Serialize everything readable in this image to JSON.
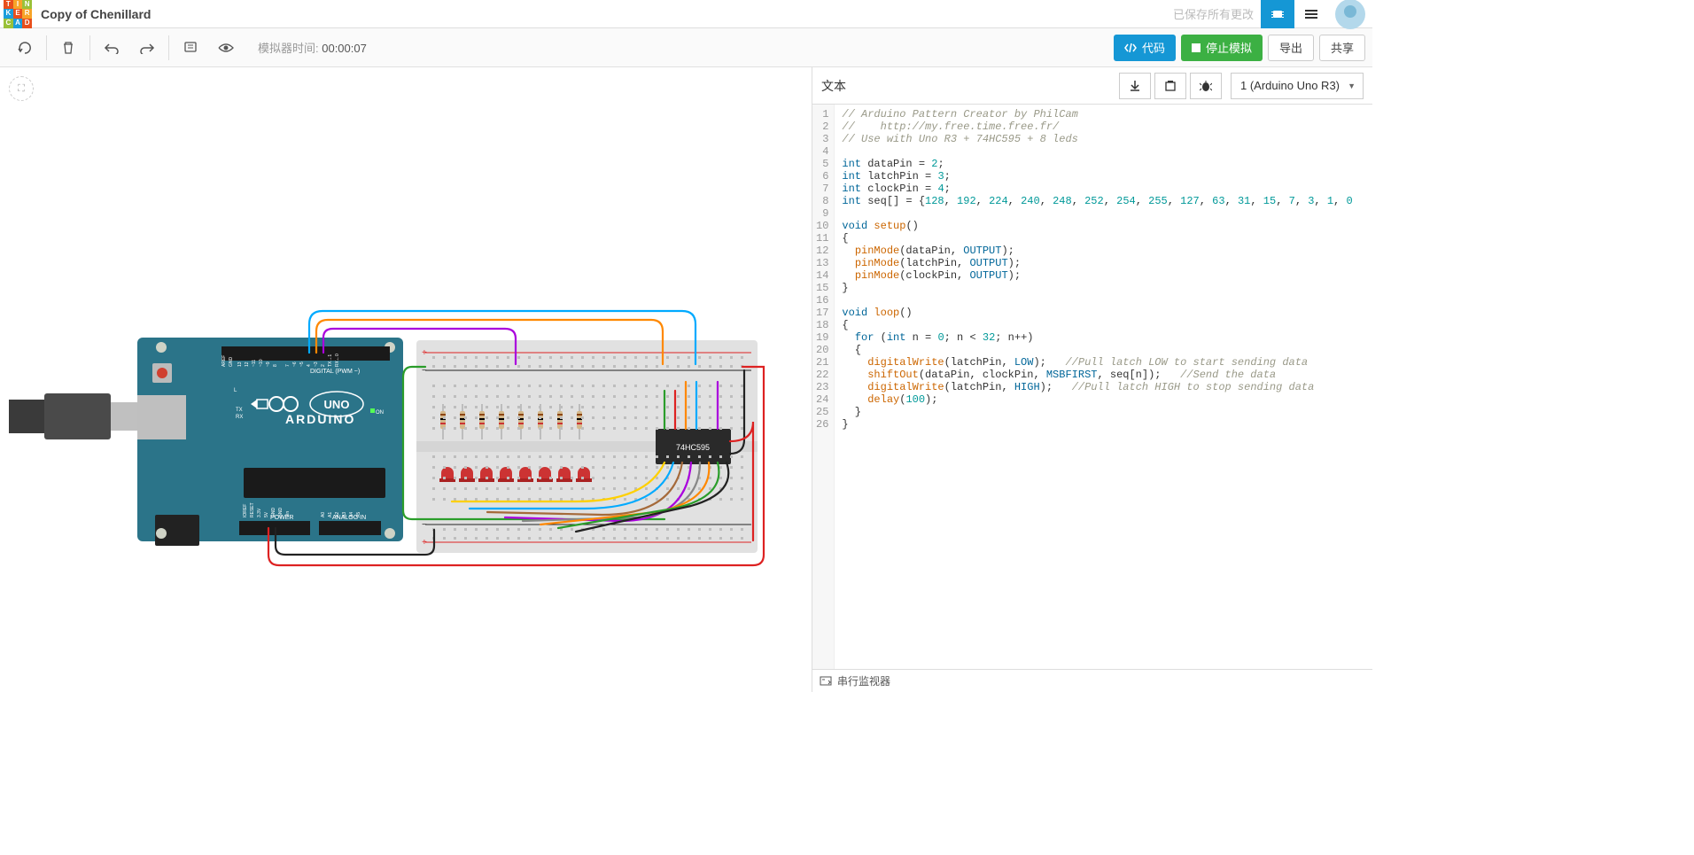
{
  "project_title": "Copy of Chenillard",
  "saved_text": "已保存所有更改",
  "toolbar": {
    "sim_time_label": "模拟器时间: ",
    "sim_time_value": "00:00:07",
    "code_btn": "代码",
    "stop_sim_btn": "停止模拟",
    "export_btn": "导出",
    "share_btn": "共享"
  },
  "code_panel": {
    "label": "文本",
    "board": "1 (Arduino Uno R3)",
    "serial_monitor": "串行监视器"
  },
  "chip_label": "74HC595",
  "arduino": {
    "brand": "ARDUINO",
    "model": "UNO",
    "digital_label": "DIGITAL (PWM ~)",
    "analog_label": "ANALOG IN",
    "power_label": "POWER",
    "tx": "TX",
    "rx": "RX",
    "on": "ON",
    "l": "L"
  },
  "code": {
    "lines": [
      {
        "n": 1,
        "t": "// Arduino Pattern Creator by PhilCam",
        "cls": "com"
      },
      {
        "n": 2,
        "t": "//    http://my.free.time.free.fr/",
        "cls": "com"
      },
      {
        "n": 3,
        "t": "// Use with Uno R3 + 74HC595 + 8 leds",
        "cls": "com"
      },
      {
        "n": 4,
        "t": "",
        "cls": ""
      },
      {
        "n": 5,
        "seg": [
          {
            "t": "int",
            "c": "ty"
          },
          {
            "t": " dataPin = ",
            "c": ""
          },
          {
            "t": "2",
            "c": "num"
          },
          {
            "t": ";",
            "c": ""
          }
        ]
      },
      {
        "n": 6,
        "seg": [
          {
            "t": "int",
            "c": "ty"
          },
          {
            "t": " latchPin = ",
            "c": ""
          },
          {
            "t": "3",
            "c": "num"
          },
          {
            "t": ";",
            "c": ""
          }
        ]
      },
      {
        "n": 7,
        "seg": [
          {
            "t": "int",
            "c": "ty"
          },
          {
            "t": " clockPin = ",
            "c": ""
          },
          {
            "t": "4",
            "c": "num"
          },
          {
            "t": ";",
            "c": ""
          }
        ]
      },
      {
        "n": 8,
        "seg": [
          {
            "t": "int",
            "c": "ty"
          },
          {
            "t": " seq[] = {",
            "c": ""
          },
          {
            "t": "128",
            "c": "num"
          },
          {
            "t": ", ",
            "c": ""
          },
          {
            "t": "192",
            "c": "num"
          },
          {
            "t": ", ",
            "c": ""
          },
          {
            "t": "224",
            "c": "num"
          },
          {
            "t": ", ",
            "c": ""
          },
          {
            "t": "240",
            "c": "num"
          },
          {
            "t": ", ",
            "c": ""
          },
          {
            "t": "248",
            "c": "num"
          },
          {
            "t": ", ",
            "c": ""
          },
          {
            "t": "252",
            "c": "num"
          },
          {
            "t": ", ",
            "c": ""
          },
          {
            "t": "254",
            "c": "num"
          },
          {
            "t": ", ",
            "c": ""
          },
          {
            "t": "255",
            "c": "num"
          },
          {
            "t": ", ",
            "c": ""
          },
          {
            "t": "127",
            "c": "num"
          },
          {
            "t": ", ",
            "c": ""
          },
          {
            "t": "63",
            "c": "num"
          },
          {
            "t": ", ",
            "c": ""
          },
          {
            "t": "31",
            "c": "num"
          },
          {
            "t": ", ",
            "c": ""
          },
          {
            "t": "15",
            "c": "num"
          },
          {
            "t": ", ",
            "c": ""
          },
          {
            "t": "7",
            "c": "num"
          },
          {
            "t": ", ",
            "c": ""
          },
          {
            "t": "3",
            "c": "num"
          },
          {
            "t": ", ",
            "c": ""
          },
          {
            "t": "1",
            "c": "num"
          },
          {
            "t": ", ",
            "c": ""
          },
          {
            "t": "0",
            "c": "num"
          }
        ]
      },
      {
        "n": 9,
        "t": "",
        "cls": ""
      },
      {
        "n": 10,
        "seg": [
          {
            "t": "void",
            "c": "ty"
          },
          {
            "t": " ",
            "c": ""
          },
          {
            "t": "setup",
            "c": "fn"
          },
          {
            "t": "()",
            "c": ""
          }
        ]
      },
      {
        "n": 11,
        "t": "{",
        "cls": ""
      },
      {
        "n": 12,
        "seg": [
          {
            "t": "  ",
            "c": ""
          },
          {
            "t": "pinMode",
            "c": "fn"
          },
          {
            "t": "(dataPin, ",
            "c": ""
          },
          {
            "t": "OUTPUT",
            "c": "str"
          },
          {
            "t": ");",
            "c": ""
          }
        ]
      },
      {
        "n": 13,
        "seg": [
          {
            "t": "  ",
            "c": ""
          },
          {
            "t": "pinMode",
            "c": "fn"
          },
          {
            "t": "(latchPin, ",
            "c": ""
          },
          {
            "t": "OUTPUT",
            "c": "str"
          },
          {
            "t": ");",
            "c": ""
          }
        ]
      },
      {
        "n": 14,
        "seg": [
          {
            "t": "  ",
            "c": ""
          },
          {
            "t": "pinMode",
            "c": "fn"
          },
          {
            "t": "(clockPin, ",
            "c": ""
          },
          {
            "t": "OUTPUT",
            "c": "str"
          },
          {
            "t": ");",
            "c": ""
          }
        ]
      },
      {
        "n": 15,
        "t": "}",
        "cls": ""
      },
      {
        "n": 16,
        "t": "",
        "cls": ""
      },
      {
        "n": 17,
        "seg": [
          {
            "t": "void",
            "c": "ty"
          },
          {
            "t": " ",
            "c": ""
          },
          {
            "t": "loop",
            "c": "fn"
          },
          {
            "t": "()",
            "c": ""
          }
        ]
      },
      {
        "n": 18,
        "t": "{",
        "cls": ""
      },
      {
        "n": 19,
        "seg": [
          {
            "t": "  ",
            "c": ""
          },
          {
            "t": "for",
            "c": "kw"
          },
          {
            "t": " (",
            "c": ""
          },
          {
            "t": "int",
            "c": "ty"
          },
          {
            "t": " n = ",
            "c": ""
          },
          {
            "t": "0",
            "c": "num"
          },
          {
            "t": "; n < ",
            "c": ""
          },
          {
            "t": "32",
            "c": "num"
          },
          {
            "t": "; n++)",
            "c": ""
          }
        ]
      },
      {
        "n": 20,
        "t": "  {",
        "cls": ""
      },
      {
        "n": 21,
        "seg": [
          {
            "t": "    ",
            "c": ""
          },
          {
            "t": "digitalWrite",
            "c": "fn"
          },
          {
            "t": "(latchPin, ",
            "c": ""
          },
          {
            "t": "LOW",
            "c": "str"
          },
          {
            "t": ");   ",
            "c": ""
          },
          {
            "t": "//Pull latch LOW to start sending data",
            "c": "com"
          }
        ]
      },
      {
        "n": 22,
        "seg": [
          {
            "t": "    ",
            "c": ""
          },
          {
            "t": "shiftOut",
            "c": "fn"
          },
          {
            "t": "(dataPin, clockPin, ",
            "c": ""
          },
          {
            "t": "MSBFIRST",
            "c": "str"
          },
          {
            "t": ", seq[n]);   ",
            "c": ""
          },
          {
            "t": "//Send the data",
            "c": "com"
          }
        ]
      },
      {
        "n": 23,
        "seg": [
          {
            "t": "    ",
            "c": ""
          },
          {
            "t": "digitalWrite",
            "c": "fn"
          },
          {
            "t": "(latchPin, ",
            "c": ""
          },
          {
            "t": "HIGH",
            "c": "str"
          },
          {
            "t": ");   ",
            "c": ""
          },
          {
            "t": "//Pull latch HIGH to stop sending data",
            "c": "com"
          }
        ]
      },
      {
        "n": 24,
        "seg": [
          {
            "t": "    ",
            "c": ""
          },
          {
            "t": "delay",
            "c": "fn"
          },
          {
            "t": "(",
            "c": ""
          },
          {
            "t": "100",
            "c": "num"
          },
          {
            "t": ");",
            "c": ""
          }
        ]
      },
      {
        "n": 25,
        "t": "  }",
        "cls": ""
      },
      {
        "n": 26,
        "t": "}",
        "cls": ""
      }
    ]
  }
}
